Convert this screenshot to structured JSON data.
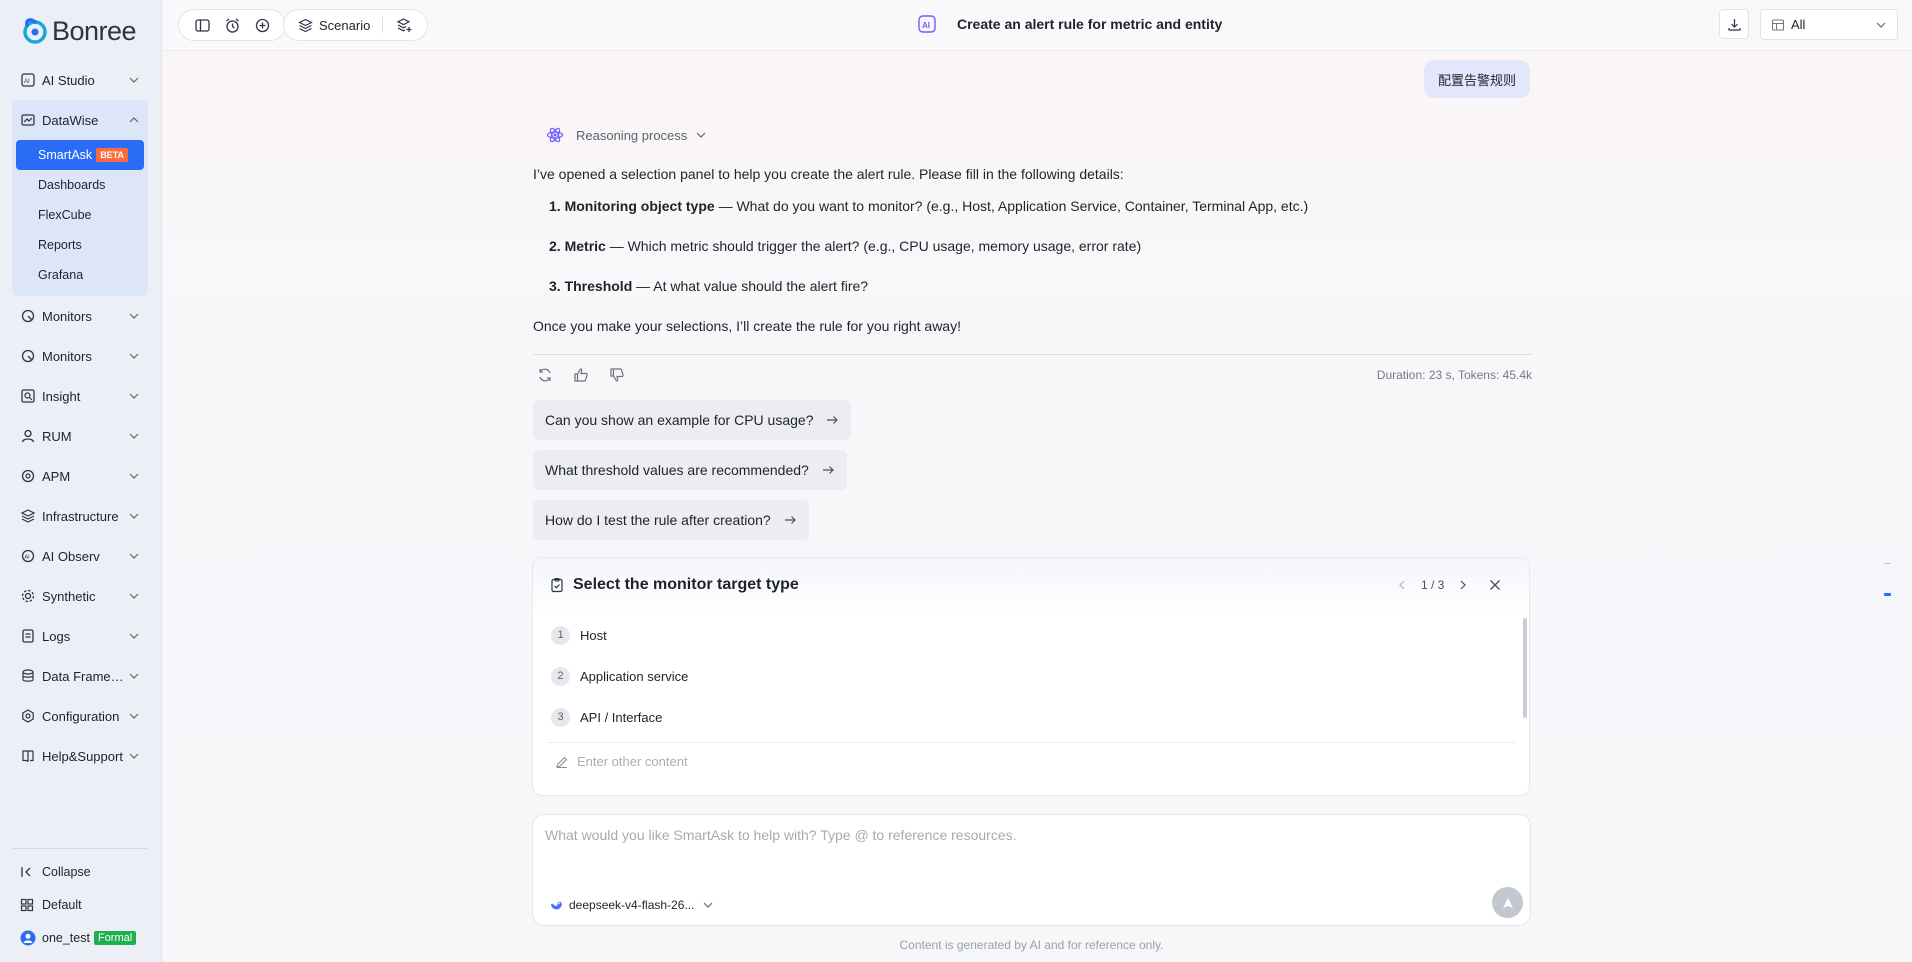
{
  "brand": {
    "name": "Bonree"
  },
  "sidebar": {
    "items": [
      {
        "label": "AI Studio",
        "icon": "ai-studio-icon"
      },
      {
        "label": "DataWise",
        "icon": "chart-icon"
      },
      {
        "label": "Monitors",
        "icon": "monitor-icon"
      },
      {
        "label": "Monitors",
        "icon": "monitor-icon"
      },
      {
        "label": "Insight",
        "icon": "search-icon"
      },
      {
        "label": "RUM",
        "icon": "user-icon"
      },
      {
        "label": "APM",
        "icon": "apm-icon"
      },
      {
        "label": "Infrastructure",
        "icon": "server-icon"
      },
      {
        "label": "AI Observ",
        "icon": "ai-observ-icon"
      },
      {
        "label": "Synthetic",
        "icon": "gear-icon"
      },
      {
        "label": "Logs",
        "icon": "logs-icon"
      },
      {
        "label": "Data Framew...",
        "icon": "database-icon"
      },
      {
        "label": "Configuration",
        "icon": "settings-icon"
      },
      {
        "label": "Help&Support",
        "icon": "book-icon"
      }
    ],
    "datawise_sub": [
      {
        "label": "SmartAsk",
        "badge": "BETA",
        "active": true
      },
      {
        "label": "Dashboards"
      },
      {
        "label": "FlexCube"
      },
      {
        "label": "Reports"
      },
      {
        "label": "Grafana"
      }
    ],
    "collapse_label": "Collapse",
    "workspace_label": "Default",
    "user_name": "one_test",
    "user_badge": "Formal"
  },
  "topbar": {
    "scenario_label": "Scenario",
    "title": "Create an alert rule for metric and entity",
    "filter_value": "All"
  },
  "chat": {
    "user_message": "配置告警规则",
    "reasoning_label": "Reasoning process",
    "intro": "I’ve opened a selection panel to help you create the alert rule. Please fill in the following details:",
    "steps": [
      {
        "num": "1.",
        "title": "Monitoring object type",
        "text": " — What do you want to monitor? (e.g., Host, Application Service, Container, Terminal App, etc.)"
      },
      {
        "num": "2.",
        "title": "Metric",
        "text": " — Which metric should trigger the alert? (e.g., CPU usage, memory usage, error rate)"
      },
      {
        "num": "3.",
        "title": "Threshold",
        "text": " — At what value should the alert fire?"
      }
    ],
    "outro": "Once you make your selections, I’ll create the rule for you right away!",
    "meta": "Duration: 23 s, Tokens: 45.4k",
    "suggestions": [
      "Can you show an example for CPU usage?",
      "What threshold values are recommended?",
      "How do I test the rule after creation?"
    ]
  },
  "panel": {
    "title": "Select the monitor target type",
    "pager": "1 / 3",
    "options": [
      {
        "num": "1",
        "label": "Host"
      },
      {
        "num": "2",
        "label": "Application service"
      },
      {
        "num": "3",
        "label": "API / Interface"
      }
    ],
    "other_placeholder": "Enter other content"
  },
  "composer": {
    "placeholder": "What would you like SmartAsk to help with? Type @ to reference resources.",
    "model": "deepseek-v4-flash-26..."
  },
  "disclaimer": "Content is generated by AI and for reference only.",
  "colors": {
    "accent": "#2b6cf6",
    "beta": "#ff6a3d",
    "formal": "#1fb04b"
  }
}
